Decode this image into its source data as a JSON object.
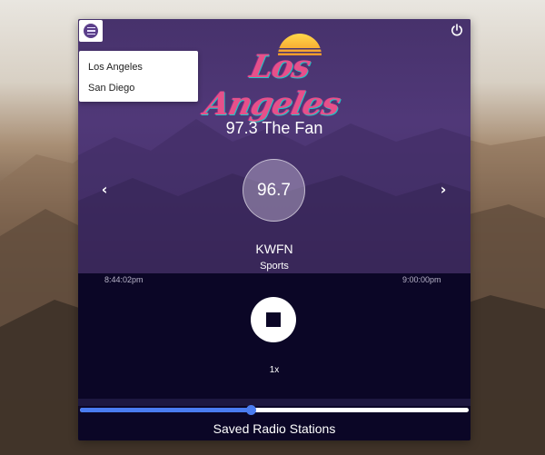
{
  "header": {
    "logo_text": "Los Angeles",
    "menu_icon": "hamburger-menu-icon",
    "power_icon": "power-icon"
  },
  "city_menu": {
    "items": [
      {
        "label": "Los Angeles"
      },
      {
        "label": "San Diego"
      }
    ]
  },
  "now_playing": {
    "station_name": "97.3 The Fan",
    "frequency": "96.7",
    "call_sign": "KWFN",
    "genre": "Sports"
  },
  "nav": {
    "prev_icon": "chevron-left-icon",
    "next_icon": "chevron-right-icon",
    "prev_glyph": "‹",
    "next_glyph": "›"
  },
  "playback": {
    "start_time": "8:44:02pm",
    "end_time": "9:00:00pm",
    "speed": "1x",
    "stop_icon": "stop-icon"
  },
  "volume": {
    "level": 0.44,
    "accent": "#4a7cf0"
  },
  "footer": {
    "saved_label": "Saved Radio Stations"
  },
  "colors": {
    "hero_bg": "#4a3470",
    "panel_bg": "#0b0626",
    "accent": "#4a7cf0"
  }
}
